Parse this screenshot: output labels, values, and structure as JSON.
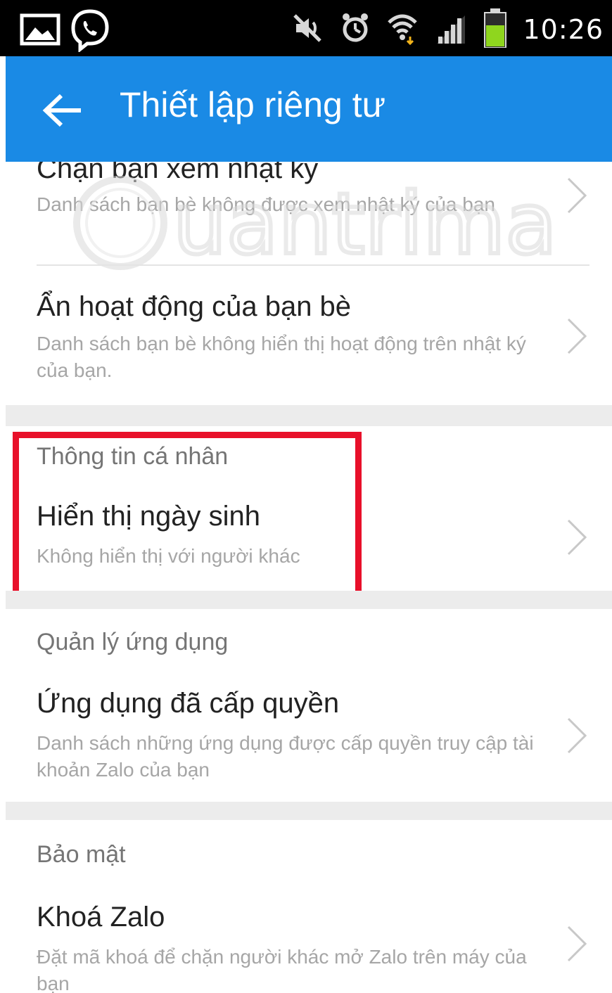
{
  "status_bar": {
    "time": "10:26",
    "icons": [
      "gallery-icon",
      "viber-icon",
      "mute-icon",
      "alarm-icon",
      "wifi-icon",
      "signal-icon",
      "battery-icon"
    ]
  },
  "app_bar": {
    "title": "Thiết lập riêng tư",
    "back_icon": "arrow-left-icon"
  },
  "rows": {
    "block_diary": {
      "title": "Chặn bạn xem nhật ký",
      "subtitle": "Danh sách bạn bè không được xem nhật ký của bạn"
    },
    "hide_activity": {
      "title": "Ẩn hoạt động của bạn bè",
      "subtitle": "Danh sách bạn bè không hiển thị hoạt động trên nhật ký của bạn."
    },
    "birthday": {
      "title": "Hiển thị ngày sinh",
      "subtitle": "Không hiển thị với người khác"
    },
    "authorized_apps": {
      "title": "Ứng dụng đã cấp quyền",
      "subtitle": "Danh sách những ứng dụng được cấp quyền truy cập tài khoản Zalo của bạn"
    },
    "lock_zalo": {
      "title": "Khoá Zalo",
      "subtitle": "Đặt mã khoá để chặn người khác mở Zalo trên máy của bạn"
    }
  },
  "sections": {
    "personal_info": "Thông tin cá nhân",
    "app_management": "Quản lý ứng dụng",
    "security": "Bảo mật"
  },
  "watermark": {
    "text": "uantrimang"
  },
  "colors": {
    "app_bar": "#1a8ae5",
    "highlight": "#e8102a",
    "section_gap": "#ececec"
  }
}
